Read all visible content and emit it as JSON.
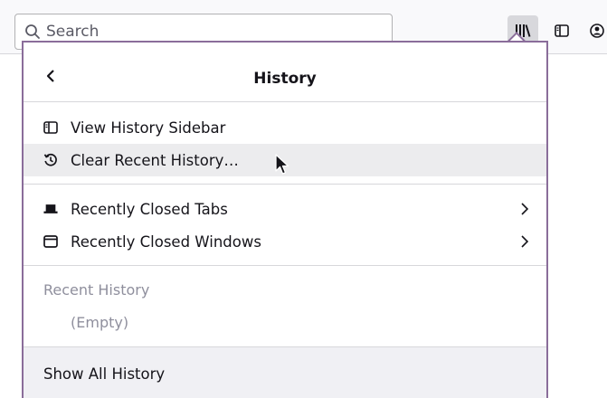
{
  "toolbar": {
    "search_placeholder": "Search",
    "icons": [
      "search-icon",
      "library-icon",
      "sidebar-icon",
      "account-icon"
    ]
  },
  "panel": {
    "title": "History",
    "items_top": [
      {
        "label": "View History Sidebar",
        "icon": "sidebar-icon"
      },
      {
        "label": "Clear Recent History…",
        "icon": "clear-history-icon"
      }
    ],
    "items_closed": [
      {
        "label": "Recently Closed Tabs",
        "icon": "tab-icon"
      },
      {
        "label": "Recently Closed Windows",
        "icon": "window-icon"
      }
    ],
    "recent_label": "Recent History",
    "recent_empty": "(Empty)",
    "footer_label": "Show All History"
  },
  "colors": {
    "panel_border": "#8a6d9a",
    "hover": "#ececee",
    "footer_bg": "#f0f0f4"
  }
}
